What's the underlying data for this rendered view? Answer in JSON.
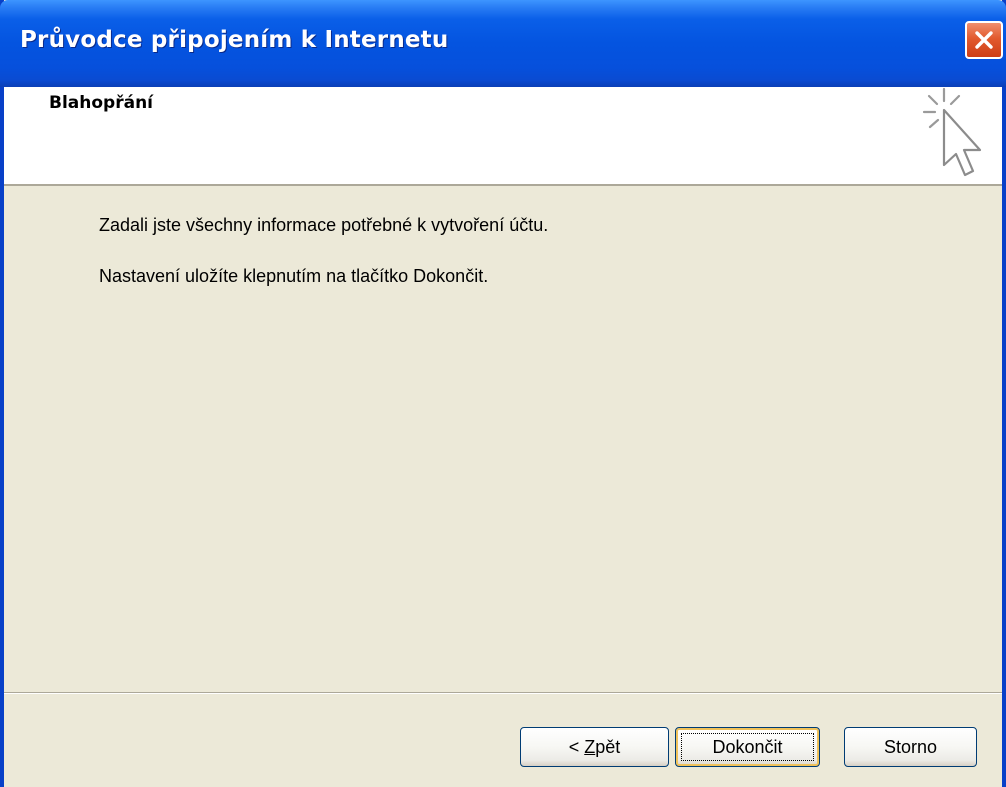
{
  "window": {
    "title": "Průvodce připojením k Internetu"
  },
  "header": {
    "title": "Blahopřání",
    "icon": "sparkle-cursor-icon"
  },
  "content": {
    "line1": "Zadali jste všechny informace potřebné k vytvoření účtu.",
    "line2": "Nastavení uložíte klepnutím na tlačítko Dokončit."
  },
  "buttons": {
    "back_prefix": "< ",
    "back_mnemonic": "Z",
    "back_rest": "pět",
    "finish": "Dokončit",
    "cancel": "Storno"
  },
  "colors": {
    "titlebar": "#0454e0",
    "dialog_bg": "#ece9d8",
    "close_button": "#e25a2e"
  }
}
